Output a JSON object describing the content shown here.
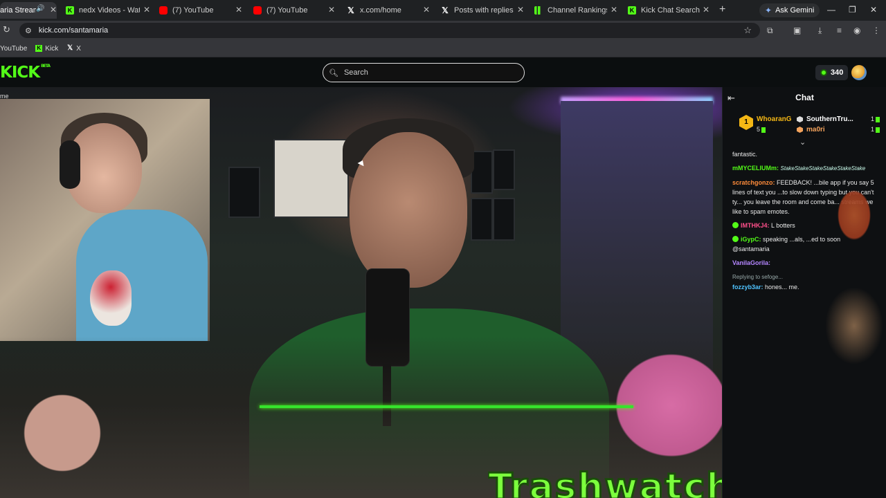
{
  "browser": {
    "tabs": [
      {
        "label": "aria Stream",
        "favicon": "kick",
        "active": true
      },
      {
        "label": "nedx Videos - Watch C",
        "favicon": "kick",
        "active": false
      },
      {
        "label": "(7) YouTube",
        "favicon": "youtube",
        "active": false
      },
      {
        "label": "(7) YouTube",
        "favicon": "youtube",
        "active": false
      },
      {
        "label": "x.com/home",
        "favicon": "x",
        "active": false
      },
      {
        "label": "Posts with replies by Tr",
        "favicon": "x",
        "active": false
      },
      {
        "label": "Channel Rankings - Kic",
        "favicon": "bars",
        "active": false
      },
      {
        "label": "Kick Chat Search",
        "favicon": "kick",
        "active": false
      }
    ],
    "ask_gemini": "Ask Gemini",
    "url": "kick.com/santamaria",
    "bookmarks": [
      {
        "label": "YouTube",
        "favicon": "youtube"
      },
      {
        "label": "Kick",
        "favicon": "kick"
      },
      {
        "label": "X",
        "favicon": "x"
      }
    ]
  },
  "site": {
    "logo": "KICK",
    "logo_badge": "BETA",
    "search_placeholder": "Search",
    "points": "340",
    "accent_color": "#53fc18"
  },
  "video": {
    "corner_text": "me",
    "overlay_title": "Trashwatch"
  },
  "chat": {
    "title": "Chat",
    "leaderboard": [
      {
        "rank": "1",
        "name": "WhoaranG",
        "count": "5",
        "color": "#f4b715"
      },
      {
        "name": "SouthernTru...",
        "count": "1",
        "color": "#ffffff"
      },
      {
        "name": "ma0ri",
        "count": "1",
        "color": "#f4a35c"
      }
    ],
    "messages": [
      {
        "user": "",
        "text": "fantastic.",
        "color": "#ffffff"
      },
      {
        "user": "mMYCELIUMm:",
        "text": "StakeStakeStakeStakeStakeStake",
        "color": "#53fc18"
      },
      {
        "user": "scratchgonzo:",
        "text": "FEEDBACK! ...bile app if you say 5 lines of text you ...to slow down typing but you can't ty... you leave the room and come ba... streams we like to spam emotes.",
        "color": "#ff8c3a"
      },
      {
        "user": "IMTHKJ4:",
        "text": "L botters",
        "color": "#ff4f8b"
      },
      {
        "user": "iGypC:",
        "text": "speaking ...als, ...ed to soon @santamaria",
        "color": "#53fc18"
      },
      {
        "user": "VanilaGorila:",
        "text": "",
        "color": "#b486ff"
      },
      {
        "user": "",
        "text": "Replying to sefoge...",
        "color": "#9aa"
      },
      {
        "user": "fozzyb3ar:",
        "text": "hones... me.",
        "color": "#4fc3ff"
      }
    ]
  }
}
